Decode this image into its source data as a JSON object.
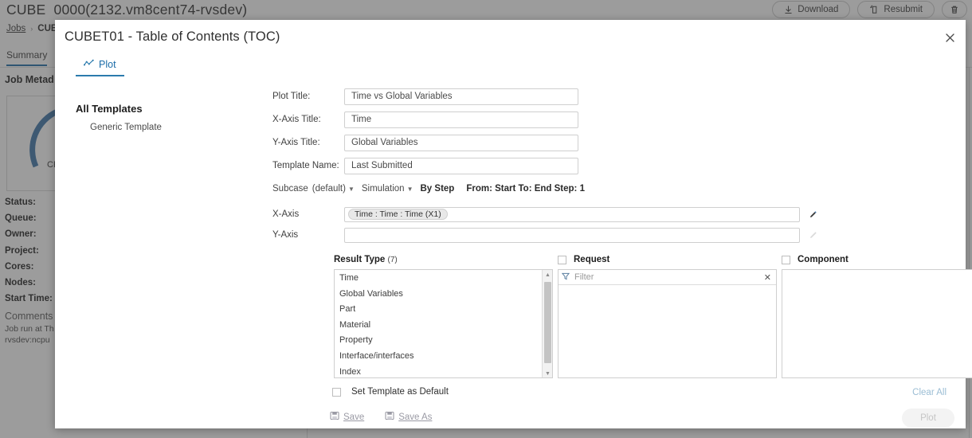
{
  "background": {
    "app_title_prefix": "CUBE",
    "app_title": "0000(2132.vm8cent74-rvsdev)",
    "buttons": [
      {
        "label": "Download",
        "icon": "download-icon"
      },
      {
        "label": "Resubmit",
        "icon": "resubmit-icon"
      },
      {
        "label": "",
        "icon": "trash-icon"
      }
    ],
    "breadcrumb": {
      "root": "Jobs",
      "separator": "›",
      "current": "CUB"
    },
    "tabs": [
      {
        "label": "Summary"
      }
    ],
    "section_title": "Job Metad",
    "card_caption": "CP",
    "meta_rows": [
      "Status:",
      "Queue:",
      "Owner:",
      "Project:",
      "Cores:",
      "Nodes:",
      "Start Time:"
    ],
    "comments_label": "Comments",
    "comments_lines": [
      "Job run at Th",
      "rvsdev:ncpu"
    ]
  },
  "modal": {
    "title": "CUBET01 - Table of Contents (TOC)",
    "close_icon": "close-icon",
    "tabs": [
      {
        "label": "Plot",
        "icon": "plot-icon",
        "active": true
      }
    ],
    "templates": {
      "heading": "All Templates",
      "items": [
        {
          "label": "Generic Template"
        }
      ]
    },
    "fields": [
      {
        "label": "Plot Title:",
        "value": "Time vs Global Variables",
        "name": "plot-title-input"
      },
      {
        "label": "X-Axis Title:",
        "value": "Time",
        "name": "x-axis-title-input"
      },
      {
        "label": "Y-Axis Title:",
        "value": "Global Variables",
        "name": "y-axis-title-input"
      },
      {
        "label": "Template Name:",
        "value": "Last Submitted",
        "name": "template-name-input"
      }
    ],
    "subcase": {
      "label": "Subcase",
      "dropdown1": "(default)",
      "dropdown2": "Simulation",
      "mode": "By Step",
      "range": "From: Start To: End Step: 1"
    },
    "axes": [
      {
        "label": "X-Axis",
        "chip": "Time : Time : Time (X1)",
        "name": "x-axis-field",
        "edit_icon": "pencil-icon"
      },
      {
        "label": "Y-Axis",
        "chip": "",
        "name": "y-axis-field",
        "edit_icon": "pencil-icon"
      }
    ],
    "result_type": {
      "title": "Result Type",
      "count": "(7)",
      "items": [
        "Time",
        "Global Variables",
        "Part",
        "Material",
        "Property",
        "Interface/interfaces",
        "Index"
      ]
    },
    "request": {
      "title": "Request",
      "checkbox_checked": false,
      "filter_placeholder": "Filter",
      "filter_icon": "funnel-icon",
      "clear_icon": "close-icon",
      "items": []
    },
    "component": {
      "title": "Component",
      "checkbox_checked": false,
      "items": []
    },
    "set_default": {
      "label": "Set Template as Default",
      "checked": false
    },
    "actions": {
      "save": "Save",
      "save_as": "Save As",
      "save_icon": "floppy-icon",
      "clear_all": "Clear All",
      "plot": "Plot"
    }
  },
  "colors": {
    "accent": "#1b6ca8",
    "tab_underline": "#2b7bad",
    "overlay": "#414141",
    "link_muted": "#9bbdd4"
  }
}
